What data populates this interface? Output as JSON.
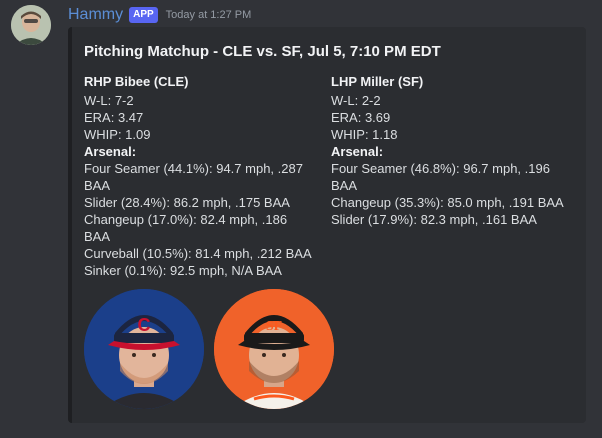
{
  "message": {
    "username": "Hammy",
    "badge": "APP",
    "timestamp": "Today at 1:27 PM"
  },
  "embed": {
    "title": "Pitching Matchup - CLE vs. SF, Jul 5, 7:10 PM EDT",
    "left": {
      "name": "RHP Bibee (CLE)",
      "wl": "W-L: 7-2",
      "era": "ERA: 3.47",
      "whip": "WHIP: 1.09",
      "arsenal_label": "Arsenal:",
      "pitches": [
        "Four Seamer (44.1%): 94.7 mph, .287 BAA",
        "Slider (28.4%): 86.2 mph, .175 BAA",
        "Changeup (17.0%): 82.4 mph, .186 BAA",
        "Curveball (10.5%): 81.4 mph, .212 BAA",
        "Sinker (0.1%): 92.5 mph, N/A BAA"
      ]
    },
    "right": {
      "name": "LHP Miller (SF)",
      "wl": "W-L: 2-2",
      "era": "ERA: 3.69",
      "whip": "WHIP: 1.18",
      "arsenal_label": "Arsenal:",
      "pitches": [
        "Four Seamer (46.8%): 96.7 mph, .196 BAA",
        "Changeup (35.3%): 85.0 mph, .191 BAA",
        "Slider (17.9%): 82.3 mph, .161 BAA"
      ]
    }
  },
  "colors": {
    "username": "#5b8ed6",
    "badge": "#5865f2",
    "cle_bg": "#1b3f8a",
    "sf_bg": "#f0622a"
  }
}
